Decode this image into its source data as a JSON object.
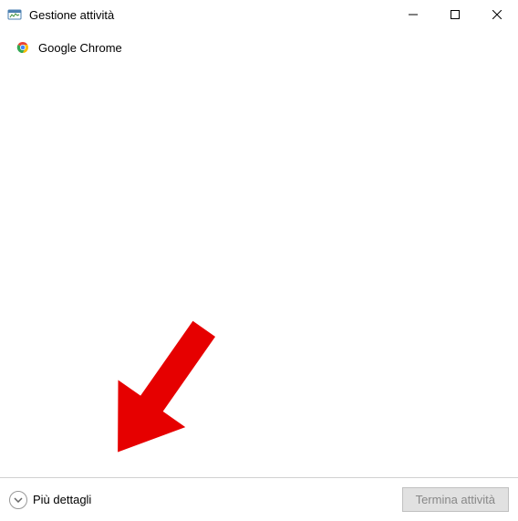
{
  "window": {
    "title": "Gestione attività"
  },
  "apps": [
    {
      "name": "Google Chrome"
    }
  ],
  "footer": {
    "more_details_label": "Più dettagli",
    "end_task_label": "Termina attività"
  }
}
